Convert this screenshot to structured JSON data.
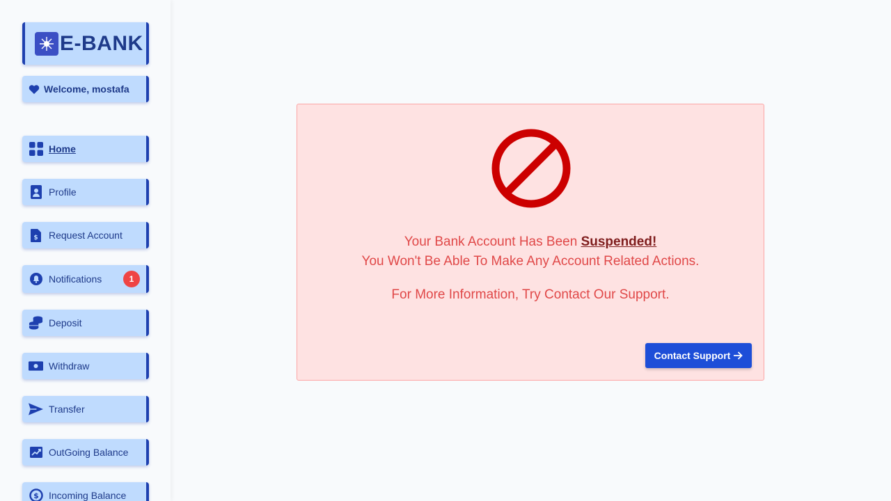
{
  "brand": {
    "name": "E-BANK"
  },
  "welcome": {
    "text": "Welcome, mostafa"
  },
  "nav": {
    "items": [
      {
        "label": "Home"
      },
      {
        "label": "Profile"
      },
      {
        "label": "Request Account"
      },
      {
        "label": "Notifications",
        "badge": "1"
      },
      {
        "label": "Deposit"
      },
      {
        "label": "Withdraw"
      },
      {
        "label": "Transfer"
      },
      {
        "label": "OutGoing Balance"
      },
      {
        "label": "Incoming Balance"
      }
    ]
  },
  "alert": {
    "line1_prefix": "Your Bank Account Has Been ",
    "line1_emphasis": "Suspended!",
    "line2": "You Won't Be Able To Make Any Account Related Actions.",
    "line3": "For More Information, Try Contact Our Support.",
    "button_label": "Contact Support"
  },
  "colors": {
    "primary": "#1e40af",
    "nav_bg": "#bfdbfe",
    "alert_bg": "#fee2e2",
    "alert_text": "#e04848",
    "ban_icon": "#cc0000",
    "button": "#1d4ed8",
    "badge": "#ef4444"
  }
}
